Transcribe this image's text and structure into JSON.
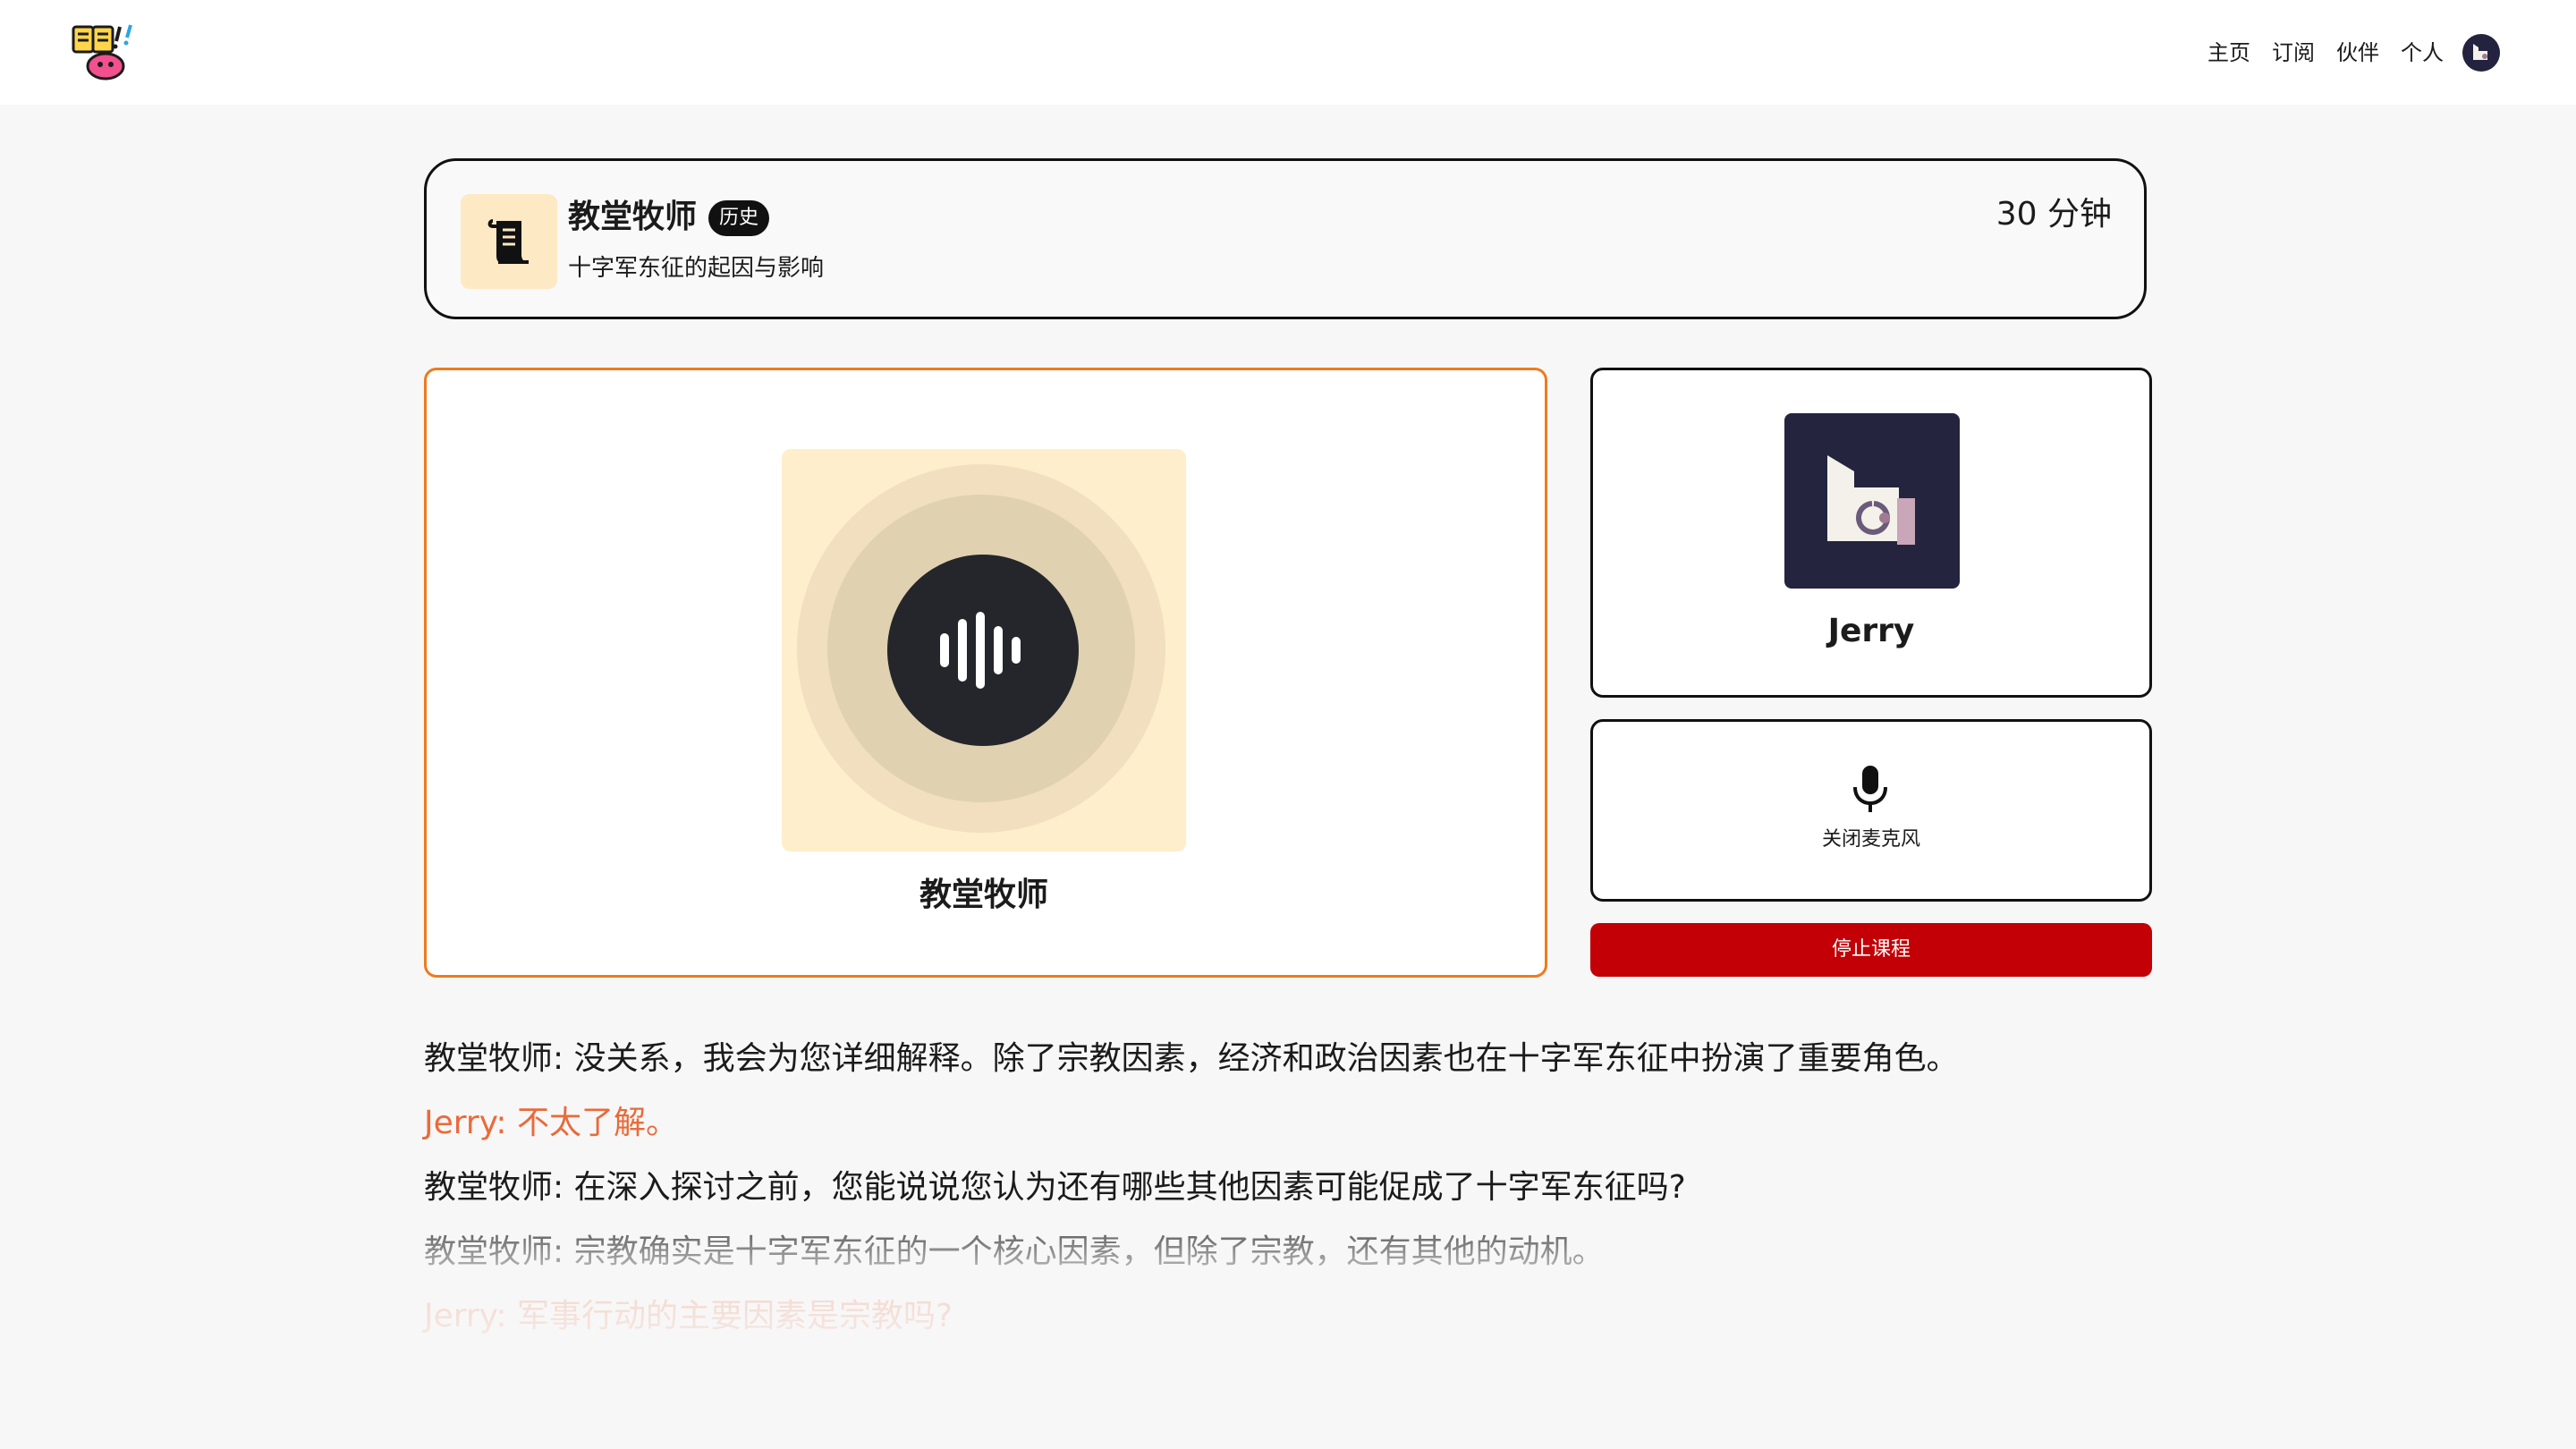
{
  "nav": {
    "items": [
      {
        "label": "主页"
      },
      {
        "label": "订阅"
      },
      {
        "label": "伙伴"
      },
      {
        "label": "个人"
      }
    ]
  },
  "course": {
    "title": "教堂牧师",
    "tag": "历史",
    "subtitle": "十字军东征的起因与影响",
    "duration": "30 分钟",
    "icon": "scroll-icon"
  },
  "tutor": {
    "name": "教堂牧师",
    "icon": "voice-wave-icon"
  },
  "user": {
    "name": "Jerry",
    "avatar": "pixel-avatar"
  },
  "controls": {
    "mic_label": "关闭麦克风",
    "stop_label": "停止课程"
  },
  "colors": {
    "accent_orange": "#ee7a1e",
    "stop_red": "#c20006",
    "user_text": "#ea6a3a",
    "voice_bg": "#ffeecb",
    "avatar_bg": "#24243f"
  },
  "transcript": [
    {
      "speaker": "teacher",
      "text": "教堂牧师: 没关系，我会为您详细解释。除了宗教因素，经济和政治因素也在十字军东征中扮演了重要角色。"
    },
    {
      "speaker": "user",
      "text": "Jerry: 不太了解。"
    },
    {
      "speaker": "teacher",
      "text": "教堂牧师: 在深入探讨之前，您能说说您认为还有哪些其他因素可能促成了十字军东征吗?"
    },
    {
      "speaker": "teacher",
      "text": "教堂牧师: 宗教确实是十字军东征的一个核心因素，但除了宗教，还有其他的动机。"
    },
    {
      "speaker": "user",
      "text": "Jerry: 军事行动的主要因素是宗教吗?"
    }
  ]
}
